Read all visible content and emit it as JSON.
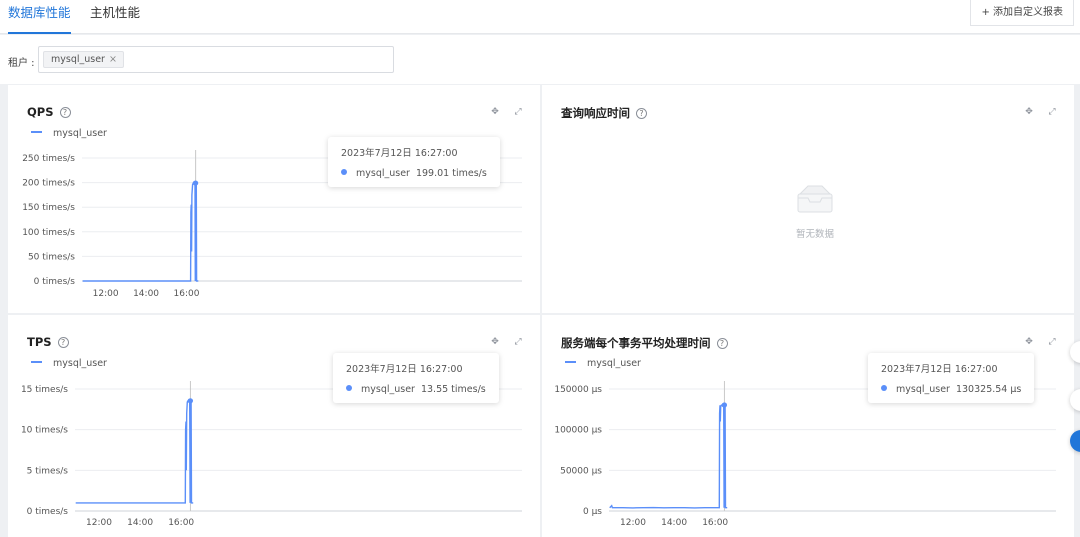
{
  "tabs": [
    {
      "label": "数据库性能",
      "active": true
    },
    {
      "label": "主机性能",
      "active": false
    }
  ],
  "add_report_label": "+ 添加自定义报表",
  "filter": {
    "label": "租户 :",
    "chip": "mysql_user",
    "chip_close": "×"
  },
  "colors": {
    "accent": "#2176d9",
    "series": "#5b8ff9",
    "tooltip_line": "#c8c8c8"
  },
  "icons": {
    "help": "question-circle-icon",
    "pin": "pin-icon",
    "expand": "expand-icon",
    "empty": "empty-box-icon"
  },
  "panels": [
    {
      "key": "qps",
      "title": "QPS",
      "has_legend": true,
      "tooltip": {
        "time": "2023年7月12日 16:27:00",
        "series": "mysql_user",
        "value": "199.01 times/s"
      },
      "y_ticks": [
        "0 times/s",
        "50 times/s",
        "100 times/s",
        "150 times/s",
        "200 times/s",
        "250 times/s"
      ],
      "x_ticks": [
        "12:00",
        "14:00",
        "16:00"
      ]
    },
    {
      "key": "query_response",
      "title": "查询响应时间",
      "has_legend": false,
      "empty_text": "暂无数据"
    },
    {
      "key": "tps",
      "title": "TPS",
      "has_legend": true,
      "tooltip": {
        "time": "2023年7月12日 16:27:00",
        "series": "mysql_user",
        "value": "13.55 times/s"
      },
      "y_ticks": [
        "0 times/s",
        "5 times/s",
        "10 times/s",
        "15 times/s"
      ],
      "x_ticks": [
        "12:00",
        "14:00",
        "16:00"
      ]
    },
    {
      "key": "txn_time",
      "title": "服务端每个事务平均处理时间",
      "has_legend": true,
      "tooltip": {
        "time": "2023年7月12日 16:27:00",
        "series": "mysql_user",
        "value": "130325.54 µs"
      },
      "y_ticks": [
        "0 µs",
        "50000 µs",
        "100000 µs",
        "150000 µs"
      ],
      "x_ticks": [
        "12:00",
        "14:00",
        "16:00"
      ]
    }
  ],
  "chart_data": [
    {
      "type": "line",
      "title": "QPS",
      "x_ticks": [
        "12:00",
        "14:00",
        "16:00"
      ],
      "ylim": [
        0,
        250
      ],
      "series": [
        {
          "name": "mysql_user",
          "x": [
            "10:52",
            "16:12",
            "16:13",
            "16:14",
            "16:15",
            "16:16",
            "16:18",
            "16:20",
            "16:22",
            "16:24",
            "16:25",
            "16:26",
            "16:27",
            "16:28",
            "16:29",
            "16:30",
            "16:31",
            "16:35"
          ],
          "y": [
            0,
            0,
            140,
            155,
            60,
            175,
            196,
            199,
            199,
            199,
            199,
            0,
            199.01,
            199,
            199,
            0,
            0,
            0
          ]
        }
      ]
    },
    {
      "type": "line",
      "title": "查询响应时间",
      "series": []
    },
    {
      "type": "line",
      "title": "TPS",
      "x_ticks": [
        "12:00",
        "14:00",
        "16:00"
      ],
      "ylim": [
        0,
        15
      ],
      "series": [
        {
          "name": "mysql_user",
          "x": [
            "10:52",
            "16:12",
            "16:13",
            "16:14",
            "16:15",
            "16:16",
            "16:18",
            "16:20",
            "16:22",
            "16:24",
            "16:25",
            "16:26",
            "16:27",
            "16:28",
            "16:29",
            "16:30",
            "16:31",
            "16:35"
          ],
          "y": [
            1,
            1,
            10,
            11,
            5,
            12,
            13.4,
            13.55,
            13.55,
            13.55,
            13.55,
            1,
            13.55,
            13.55,
            13.55,
            1,
            1,
            1
          ]
        }
      ]
    },
    {
      "type": "line",
      "title": "服务端每个事务平均处理时间",
      "x_ticks": [
        "12:00",
        "14:00",
        "16:00"
      ],
      "ylim": [
        0,
        150000
      ],
      "series": [
        {
          "name": "mysql_user",
          "x": [
            "10:52",
            "10:58",
            "11:00",
            "11:30",
            "12:00",
            "12:30",
            "13:00",
            "13:30",
            "14:00",
            "14:30",
            "15:00",
            "15:30",
            "16:00",
            "16:12",
            "16:13",
            "16:14",
            "16:15",
            "16:16",
            "16:18",
            "16:20",
            "16:22",
            "16:24",
            "16:25",
            "16:26",
            "16:27",
            "16:28",
            "16:29",
            "16:30",
            "16:31",
            "16:35"
          ],
          "y": [
            4000,
            6500,
            4000,
            4100,
            3800,
            4000,
            4200,
            3900,
            4000,
            4100,
            3800,
            4000,
            4000,
            4000,
            120000,
            130000,
            110000,
            128000,
            130000,
            130325.54,
            130300,
            130300,
            130300,
            4000,
            130325.54,
            130300,
            130300,
            4000,
            4000,
            4000
          ]
        }
      ]
    }
  ]
}
